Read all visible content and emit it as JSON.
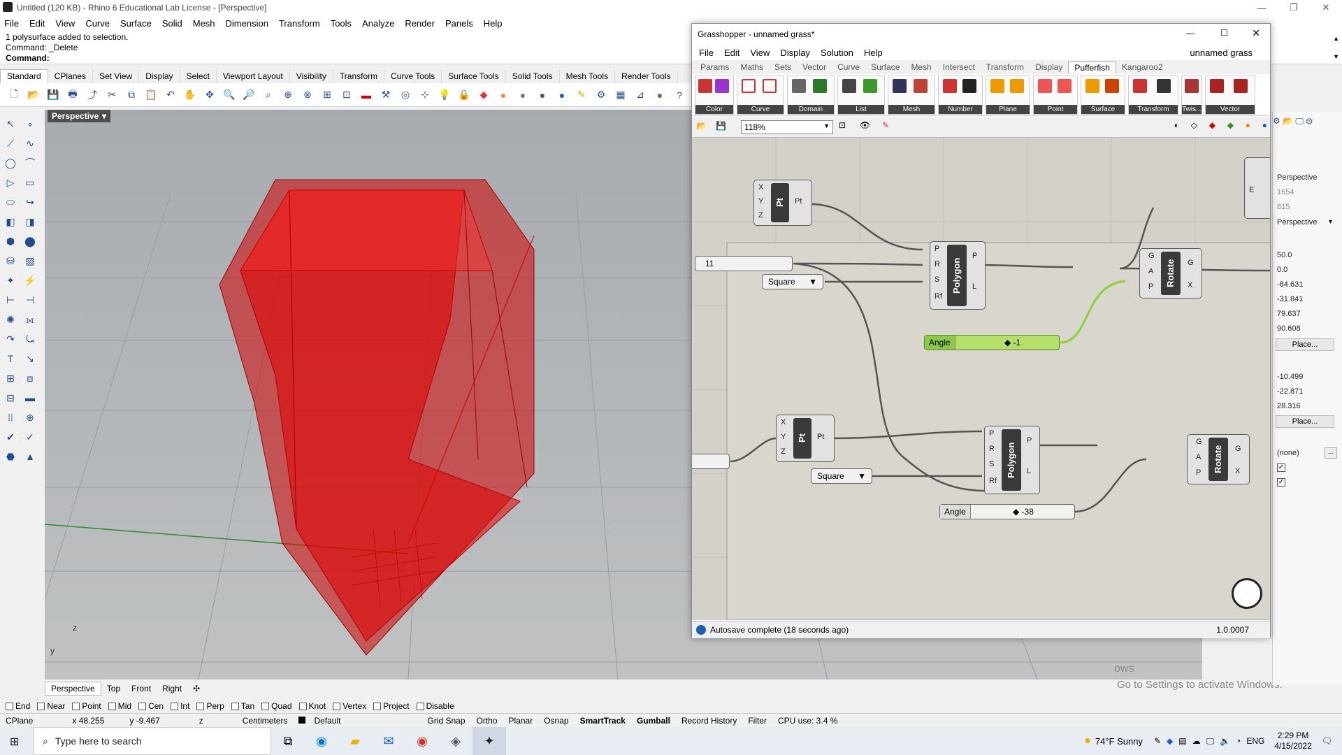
{
  "rhino": {
    "title": "Untitled (120 KB) - Rhino 6 Educational Lab License - [Perspective]",
    "menu": [
      "File",
      "Edit",
      "View",
      "Curve",
      "Surface",
      "Solid",
      "Mesh",
      "Dimension",
      "Transform",
      "Tools",
      "Analyze",
      "Render",
      "Panels",
      "Help"
    ],
    "command_history": [
      "1 polysurface added to selection.",
      "Command: _Delete"
    ],
    "command_prompt": "Command:",
    "tabs": [
      "Standard",
      "CPlanes",
      "Set View",
      "Display",
      "Select",
      "Viewport Layout",
      "Visibility",
      "Transform",
      "Curve Tools",
      "Surface Tools",
      "Solid Tools",
      "Mesh Tools",
      "Render Tools"
    ],
    "viewport_label": "Perspective",
    "viewport_tabs": [
      "Perspective",
      "Top",
      "Front",
      "Right"
    ],
    "osnaps": [
      {
        "label": "End",
        "checked": false
      },
      {
        "label": "Near",
        "checked": false
      },
      {
        "label": "Point",
        "checked": false
      },
      {
        "label": "Mid",
        "checked": false
      },
      {
        "label": "Cen",
        "checked": false
      },
      {
        "label": "Int",
        "checked": false
      },
      {
        "label": "Perp",
        "checked": false
      },
      {
        "label": "Tan",
        "checked": false
      },
      {
        "label": "Quad",
        "checked": false
      },
      {
        "label": "Knot",
        "checked": false
      },
      {
        "label": "Vertex",
        "checked": false
      },
      {
        "label": "Project",
        "checked": false
      },
      {
        "label": "Disable",
        "checked": false
      }
    ],
    "status": {
      "cplane": "CPlane",
      "x": "x 48.255",
      "y": "y -9.467",
      "z": "z",
      "units": "Centimeters",
      "layer": "Default",
      "toggles": [
        "Grid Snap",
        "Ortho",
        "Planar",
        "Osnap",
        "SmartTrack",
        "Gumball",
        "Record History",
        "Filter"
      ],
      "cpu": "CPU use: 3.4 %"
    },
    "axis_labels": {
      "z": "z",
      "y": "y"
    }
  },
  "properties_panel": {
    "view": "Perspective",
    "width": "1654",
    "height": "815",
    "projection": "Perspective",
    "lens": "50.0",
    "rotation": "0.0",
    "camera": [
      "-84.631",
      "-31.841",
      "79.637"
    ],
    "lens2": "90.608",
    "place_label": "Place...",
    "target": [
      "-10.499",
      "-22.871",
      "28.316"
    ],
    "none_label": "(none)",
    "more": "..."
  },
  "grasshopper": {
    "title": "Grasshopper - unnamed grass*",
    "filename": "unnamed grass",
    "menu": [
      "File",
      "Edit",
      "View",
      "Display",
      "Solution",
      "Help"
    ],
    "tabs": [
      "Params",
      "Maths",
      "Sets",
      "Vector",
      "Curve",
      "Surface",
      "Mesh",
      "Intersect",
      "Transform",
      "Display",
      "Pufferfish",
      "Kangaroo2"
    ],
    "active_tab": "Pufferfish",
    "ribbon_groups": [
      "Color",
      "Curve",
      "Domain",
      "List",
      "Mesh",
      "Number",
      "Plane",
      "Point",
      "Surface",
      "Transform",
      "Twis...",
      "Vector"
    ],
    "zoom": "118%",
    "status": "Autosave complete (18 seconds ago)",
    "version": "1.0.0007",
    "components": {
      "pt_label": "Pt",
      "pt_inputs": [
        "X",
        "Y",
        "Z"
      ],
      "polygon_label": "Polygon",
      "polygon_inputs": [
        "P",
        "R",
        "S",
        "Rf"
      ],
      "polygon_outputs": [
        "P",
        "L"
      ],
      "rotate_label": "Rotate",
      "rotate_inputs": [
        "G",
        "A",
        "P"
      ],
      "rotate_outputs": [
        "G",
        "X"
      ],
      "square_label": "Square",
      "slider1_value": "11",
      "angle_label": "Angle",
      "angle1_value": "-1",
      "angle2_value": "-38",
      "edge_label": "E"
    }
  },
  "taskbar": {
    "search_placeholder": "Type here to search",
    "weather": "74°F  Sunny",
    "lang": "ENG",
    "time": "2:29 PM",
    "date": "4/15/2022"
  },
  "watermark": [
    "ows",
    "Go to Settings to activate Windows."
  ]
}
